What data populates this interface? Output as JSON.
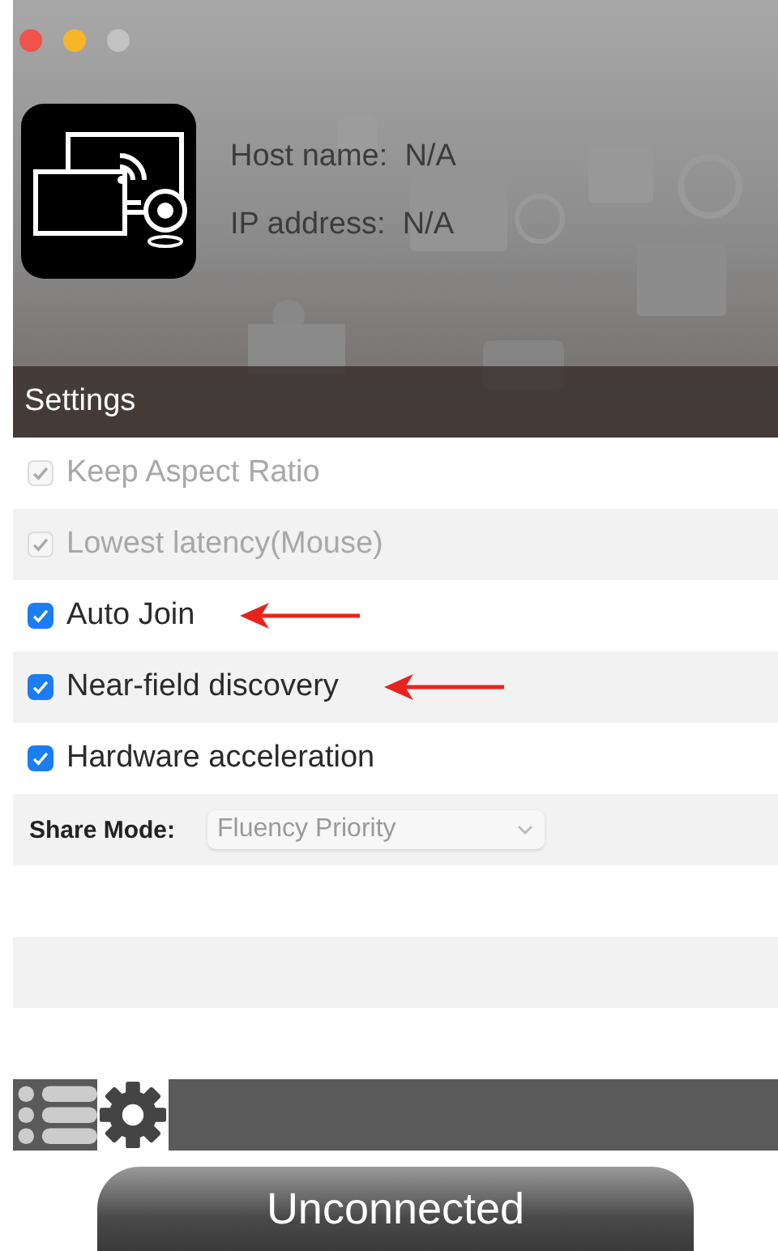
{
  "window": {
    "controls": [
      {
        "kind": "close",
        "disabled": false
      },
      {
        "kind": "minimize",
        "disabled": false
      },
      {
        "kind": "zoom",
        "disabled": true
      }
    ]
  },
  "device": {
    "host_name": "Host name:  N/A",
    "ip_address": "IP address:  N/A"
  },
  "settings": {
    "title": "Settings",
    "options": [
      {
        "label": "Keep Aspect Ratio",
        "checked": true,
        "disabled": true,
        "arrow": false
      },
      {
        "label": "Lowest latency(Mouse)",
        "checked": true,
        "disabled": true,
        "arrow": false
      },
      {
        "label": "Auto Join",
        "checked": true,
        "disabled": false,
        "arrow": true
      },
      {
        "label": "Near-field discovery",
        "checked": true,
        "disabled": false,
        "arrow": true
      },
      {
        "label": "Hardware acceleration",
        "checked": true,
        "disabled": false,
        "arrow": false
      }
    ],
    "share_mode": {
      "label": "Share Mode:",
      "value": "Fluency Priority",
      "disabled": true
    }
  },
  "tabs": [
    {
      "kind": "list",
      "selected": false
    },
    {
      "kind": "gear",
      "selected": true
    }
  ],
  "connect_button": {
    "label": "Unconnected"
  }
}
